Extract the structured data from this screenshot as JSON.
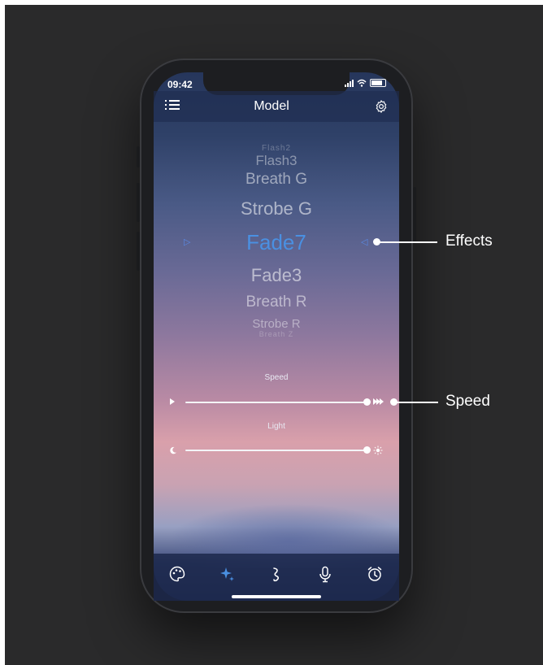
{
  "status_bar": {
    "time": "09:42"
  },
  "header": {
    "title": "Model"
  },
  "effects_wheel": {
    "items_above": [
      "Flash2",
      "Flash3",
      "Breath G",
      "Strobe G"
    ],
    "selected": "Fade7",
    "items_below": [
      "Fade3",
      "Breath R",
      "Strobe R",
      "Breath Z"
    ]
  },
  "sliders": {
    "speed": {
      "label": "Speed",
      "value": 1.0
    },
    "light": {
      "label": "Light",
      "value": 1.0
    }
  },
  "callouts": {
    "effects": "Effects",
    "speed": "Speed"
  },
  "tabs": [
    "palette-icon",
    "sparkle-icon",
    "music-note-icon",
    "microphone-icon",
    "alarm-clock-icon"
  ],
  "colors": {
    "accent": "#4a90e2",
    "text": "#ffffff"
  }
}
